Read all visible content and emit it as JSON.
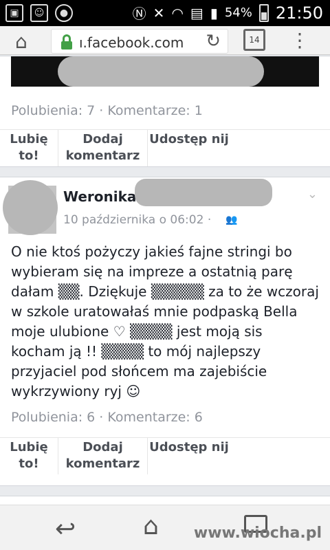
{
  "status_bar": {
    "battery_percent": "54%",
    "time": "21:50",
    "icons": [
      "image-icon",
      "app-icon",
      "record-icon",
      "nfc-icon",
      "mute-icon",
      "wifi-icon",
      "notification-icon",
      "signal-icon",
      "battery-icon"
    ]
  },
  "browser": {
    "url": "ı.facebook.com",
    "tab_count": "14"
  },
  "post1": {
    "stats": "Polubienia: 7 · Komentarze: 1",
    "actions": {
      "like": "Lubię to!",
      "comment": "Dodaj komentarz",
      "share": "Udostęp nij"
    }
  },
  "post2": {
    "author": "Weronika",
    "date": "10 października o 06:02 ·",
    "body": "O nie ktoś pożyczy jakieś fajne stringi bo wybieram się na impreze a ostatnią parę dałam ▒▒. Dziękuje ▒▒▒▒▒ za to że wczoraj w szkole uratowałaś mnie podpaską Bella moje ulubione ♡ ▒▒▒▒ jest moją sis kocham ją !! ▒▒▒▒ to mój najlepszy przyjaciel pod słońcem ma zajebiście wykrzywiony ryj ☺",
    "stats": "Polubienia: 6 · Komentarze: 6",
    "actions": {
      "like": "Lubię to!",
      "comment": "Dodaj komentarz",
      "share": "Udostęp nij"
    }
  },
  "watermark": "www.wiocha.pl"
}
